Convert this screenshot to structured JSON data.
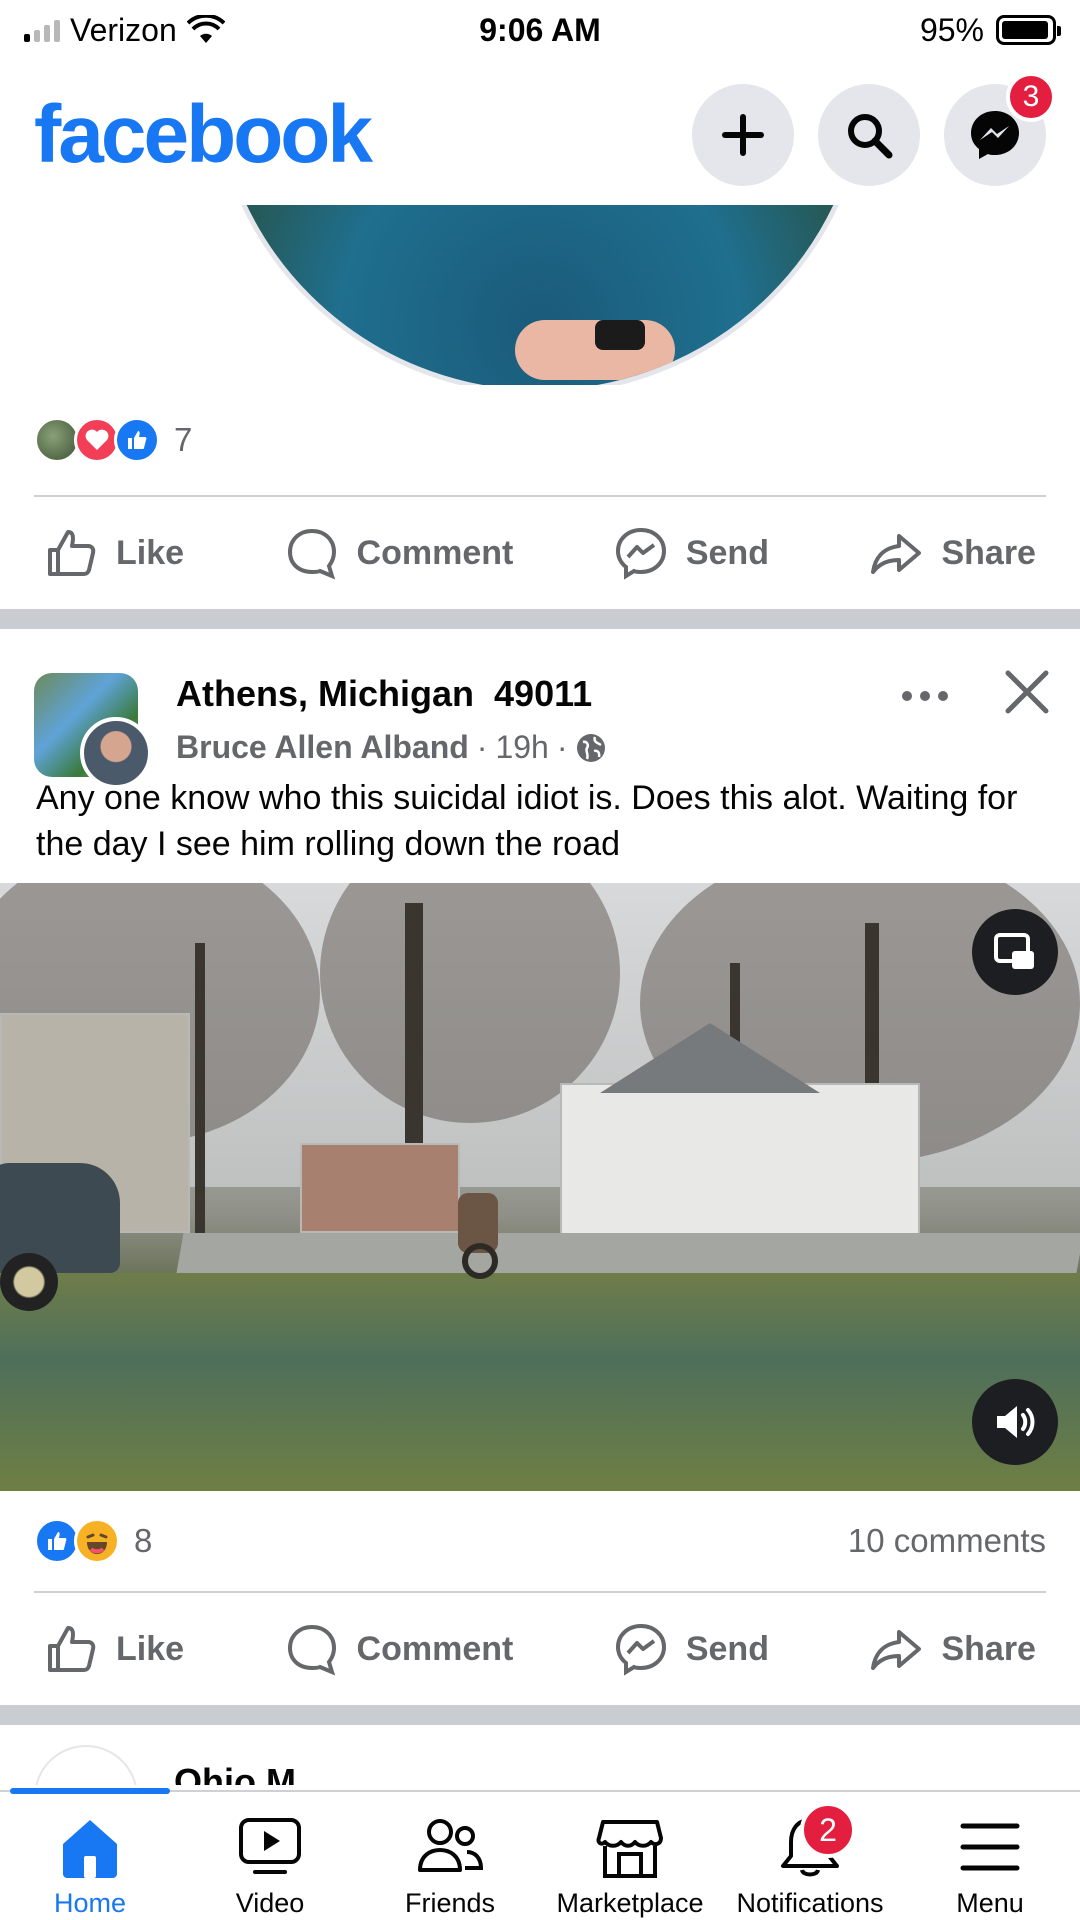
{
  "status_bar": {
    "carrier": "Verizon",
    "time": "9:06 AM",
    "battery": "95%",
    "battery_level": 0.95
  },
  "header": {
    "logo": "facebook",
    "messenger_badge": "3"
  },
  "previous_post": {
    "reaction_count": "7"
  },
  "actions": {
    "like": "Like",
    "comment": "Comment",
    "send": "Send",
    "share": "Share"
  },
  "post": {
    "group": "Athens, Michigan  49011",
    "author": "Bruce Allen Alband",
    "time": "19h",
    "text": "Any one know who this suicidal idiot is. Does this alot. Waiting for the day I see him rolling down the road",
    "reaction_count": "8",
    "comments": "10 comments"
  },
  "next_post": {
    "group_partial": "Ohio M..."
  },
  "tabs": [
    {
      "label": "Home",
      "active": true
    },
    {
      "label": "Video"
    },
    {
      "label": "Friends"
    },
    {
      "label": "Marketplace"
    },
    {
      "label": "Notifications",
      "badge": "2"
    },
    {
      "label": "Menu"
    }
  ],
  "colors": {
    "brand": "#1877f2",
    "badge": "#e41e3f",
    "secondary_text": "#65676b"
  }
}
